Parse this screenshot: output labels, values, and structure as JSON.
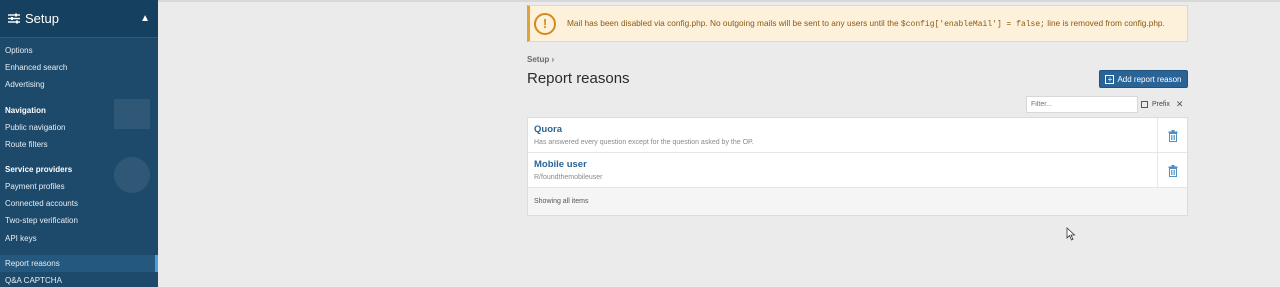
{
  "sidebar": {
    "title": "Setup",
    "icon": "sliders-icon",
    "items_top": [
      "Options",
      "Enhanced search",
      "Advertising"
    ],
    "group_nav": "Navigation",
    "items_nav": [
      "Public navigation",
      "Route filters"
    ],
    "group_providers": "Service providers",
    "items_providers": [
      "Payment profiles",
      "Connected accounts",
      "Two-step verification",
      "API keys"
    ],
    "items_bottom": [
      "Report reasons",
      "Q&A CAPTCHA"
    ]
  },
  "alert": {
    "text_before": "Mail has been disabled via config.php. No outgoing mails will be sent to any users until the ",
    "code": "$config['enableMail'] = false;",
    "text_after": " line is removed from config.php.",
    "color": "#d38b1e"
  },
  "breadcrumb": "Setup",
  "page_title": "Report reasons",
  "add_button": "Add report reason",
  "filter": {
    "placeholder": "Filter...",
    "prefix_label": "Prefix"
  },
  "items": [
    {
      "title": "Quora",
      "description": "Has answered every question except for the question asked by the OP."
    },
    {
      "title": "Mobile user",
      "description": "R/foundthemobileuser"
    }
  ],
  "footer": "Showing all items",
  "colors": {
    "sidebar_bg": "#1d4a6b",
    "accent": "#2a6496",
    "alert_bg": "#fdf1dc"
  }
}
